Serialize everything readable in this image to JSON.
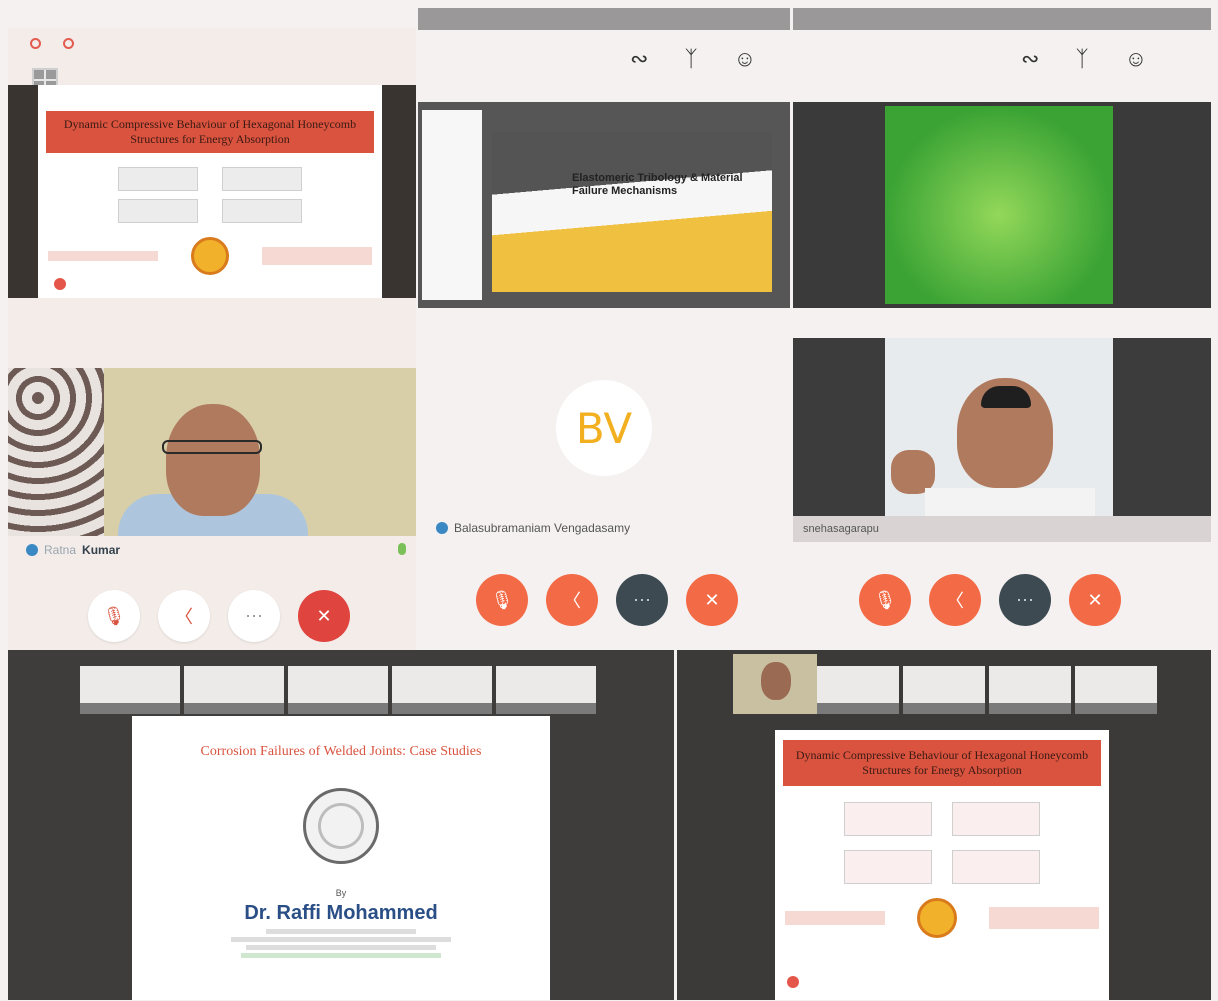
{
  "top_left": {
    "slide_title": "Dynamic Compressive Behaviour of Hexagonal Honeycomb Structures for Energy Absorption",
    "participant_name_first": "Ratna",
    "participant_name_last": "Kumar"
  },
  "top_middle": {
    "slide_title": "Elastomeric Tribology & Material Failure Mechanisms",
    "avatar_initials": "BV",
    "participant_name": "Balasubramaniam Vengadasamy"
  },
  "top_right": {
    "participant_name": "snehasagarapu"
  },
  "bottom_left": {
    "slide_title": "Corrosion Failures of Welded Joints: Case Studies",
    "by": "By",
    "presenter": "Dr. Raffi Mohammed"
  },
  "bottom_right": {
    "slide_title": "Dynamic Compressive Behaviour of Hexagonal Honeycomb Structures for Energy Absorption"
  },
  "colors": {
    "accent_red": "#d9533f",
    "end_call_red": "#e0443f",
    "call_orange": "#f36a46",
    "dark_button": "#3d4a52",
    "avatar_gold": "#f2b021"
  },
  "icons": [
    "mic-off-icon",
    "camera-off-icon",
    "more-icon",
    "end-call-icon",
    "pen-icon",
    "bluetooth-icon",
    "user-icon",
    "grid-icon"
  ]
}
